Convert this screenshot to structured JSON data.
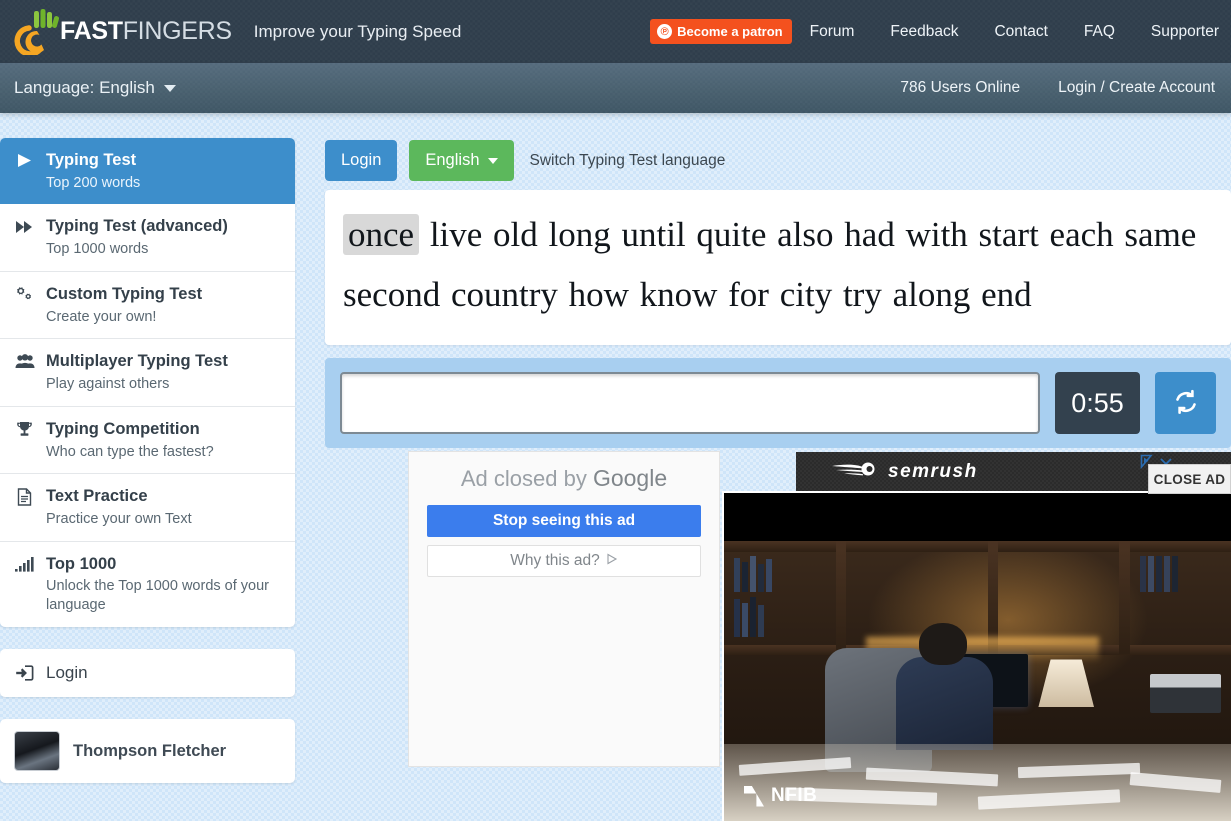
{
  "header": {
    "logo_text_bold": "FAST",
    "logo_text_thin": "FINGERS",
    "tagline": "Improve your Typing Speed",
    "patron_label": "Become a patron",
    "patron_color": "#f4511e",
    "nav": [
      {
        "label": "Forum"
      },
      {
        "label": "Feedback"
      },
      {
        "label": "Contact"
      },
      {
        "label": "FAQ"
      },
      {
        "label": "Supporter"
      }
    ]
  },
  "subheader": {
    "language_label": "Language: English",
    "users_online": "786 Users Online",
    "login_link": "Login / Create Account"
  },
  "sidebar": {
    "items": [
      {
        "icon": "play-icon",
        "title": "Typing Test",
        "subtitle": "Top 200 words",
        "active": true
      },
      {
        "icon": "forward-icon",
        "title": "Typing Test (advanced)",
        "subtitle": "Top 1000 words",
        "active": false
      },
      {
        "icon": "cogs-icon",
        "title": "Custom Typing Test",
        "subtitle": "Create your own!",
        "active": false
      },
      {
        "icon": "users-icon",
        "title": "Multiplayer Typing Test",
        "subtitle": "Play against others",
        "active": false
      },
      {
        "icon": "trophy-icon",
        "title": "Typing Competition",
        "subtitle": "Who can type the fastest?",
        "active": false
      },
      {
        "icon": "document-icon",
        "title": "Text Practice",
        "subtitle": "Practice your own Text",
        "active": false
      },
      {
        "icon": "signal-bars-icon",
        "title": "Top 1000",
        "subtitle": "Unlock the Top 1000 words of your language",
        "active": false
      }
    ],
    "login_label": "Login",
    "user_name": "Thompson Fletcher"
  },
  "main": {
    "login_button": "Login",
    "language_button": "English",
    "switch_note": "Switch Typing Test language",
    "words_current": "once",
    "words_rest": "live old long until quite also had with start each same second country how know for city try along end",
    "input_value": "",
    "input_placeholder": "",
    "timer": "0:55",
    "redo_icon": "refresh-icon",
    "accent_blue": "#3d8ecb",
    "accent_green": "#5cb85c"
  },
  "ads": {
    "google": {
      "title_prefix": "Ad closed by ",
      "title_brand": "Google",
      "stop_button": "Stop seeing this ad",
      "why_button": "Why this ad?"
    },
    "banner": {
      "brand": "semrush",
      "close_label": "CLOSE AD",
      "adchoices_icon": "adchoices-icon"
    },
    "video": {
      "watermark": "NFIB"
    }
  }
}
